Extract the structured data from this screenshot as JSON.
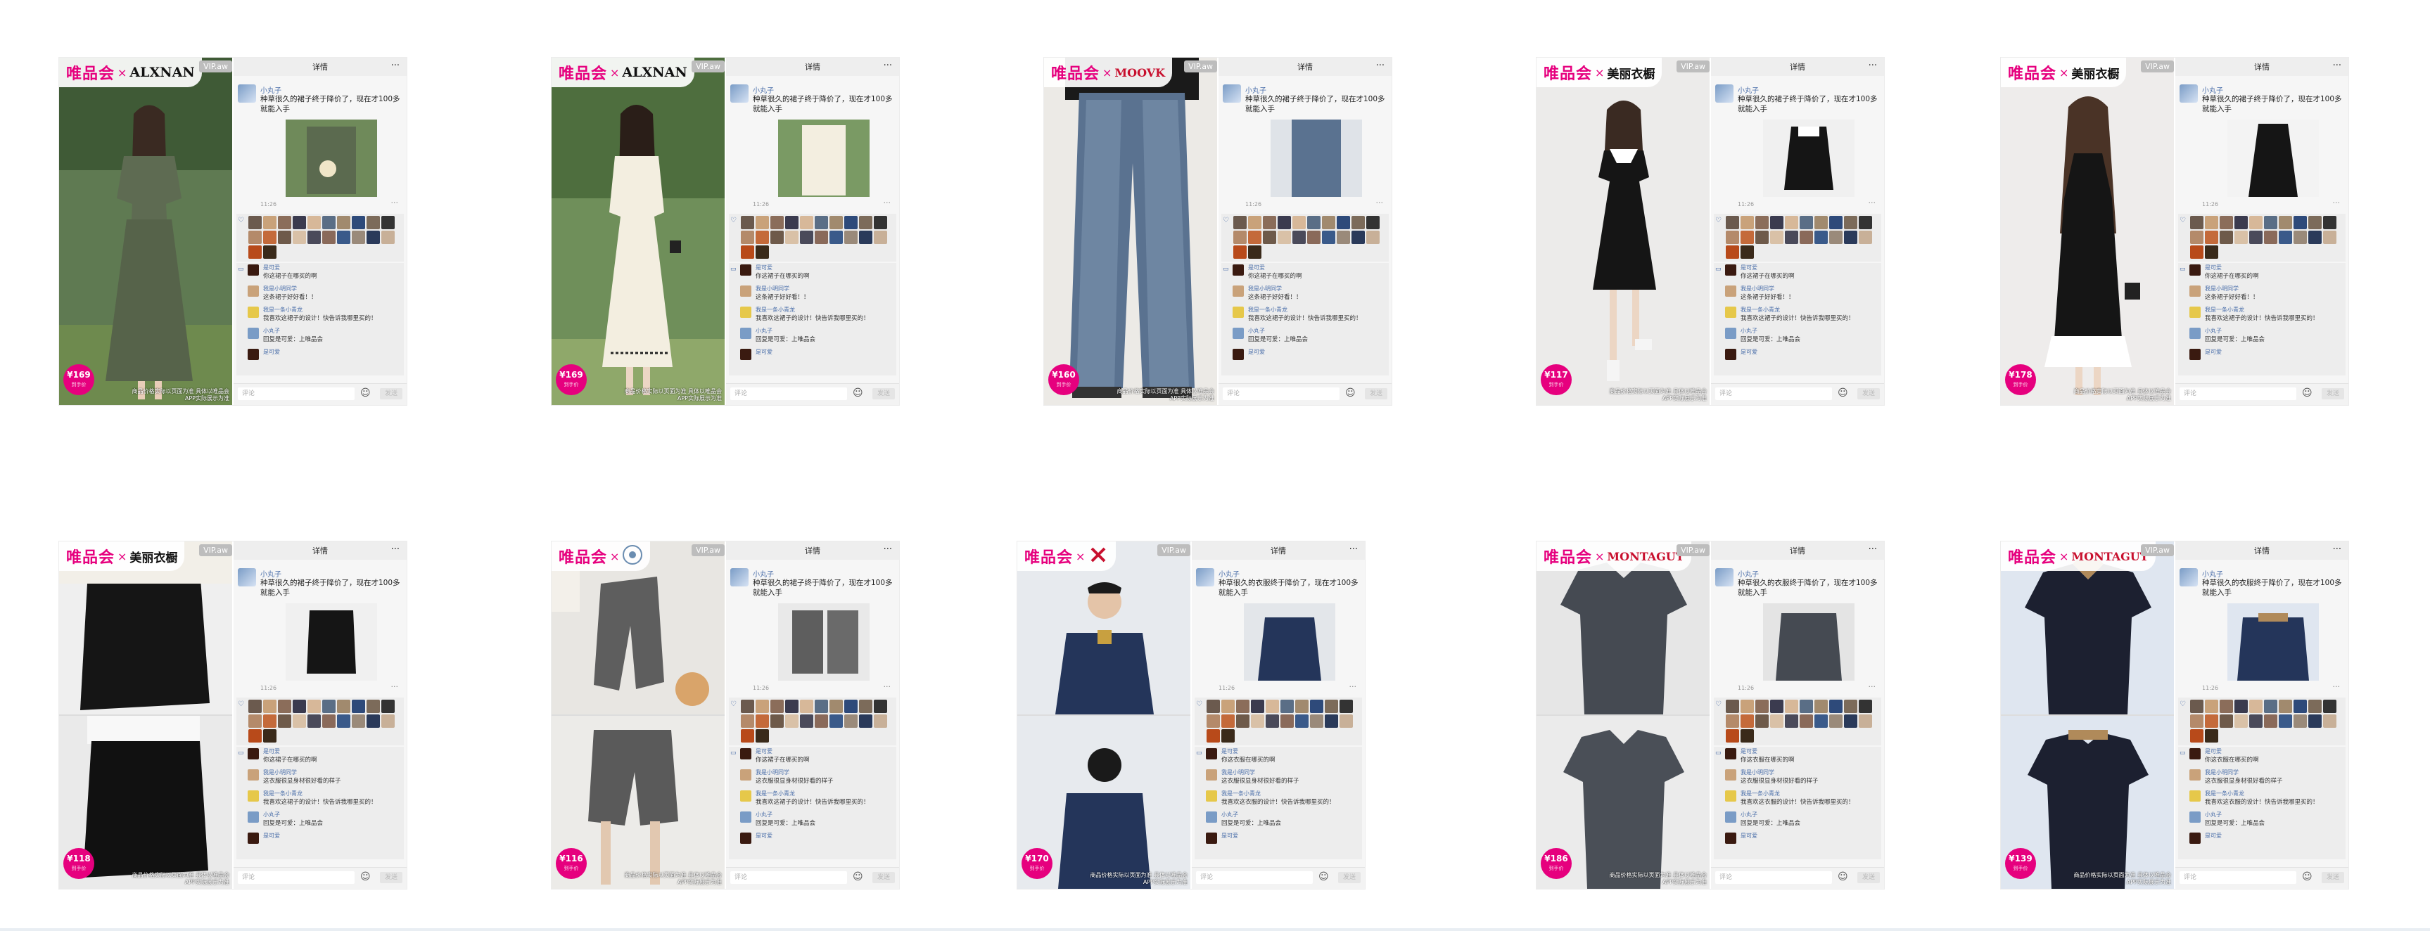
{
  "common": {
    "brand_wph": "唯品会",
    "brand_x": "×",
    "vip_tag": "VIP.aw",
    "topbar_title": "详情",
    "more": "···",
    "nick": "小丸子",
    "post_text_dress": "种草很久的裙子终于降价了，现在才100多就能入手",
    "post_text_men": "种草很久的衣服终于降价了，现在才100多就能入手",
    "time": "11:26",
    "like_heart": "♡",
    "comment_icon": "▭",
    "input_placeholder": "评论",
    "emoji": "☺",
    "send": "发送",
    "price_sub": "到手价",
    "disclaimer": "商品价格实际以页面为准 具体以唯品会APP实际展示为准",
    "comments_dress": [
      {
        "name": "是可爱",
        "text": "你这裙子在哪买的啊"
      },
      {
        "name": "我是小明同学",
        "text": "这条裙子好好看！！"
      },
      {
        "name": "我是一条小青龙",
        "text": "我喜欢这裙子的设计！快告诉我哪里买的！"
      },
      {
        "name": "小丸子",
        "text": "回复是可爱：上唯品会"
      },
      {
        "name": "是可爱",
        "text": ""
      }
    ],
    "comments_men": [
      {
        "name": "是可爱",
        "text": "你这衣服在哪买的啊"
      },
      {
        "name": "我是小明同学",
        "text": "这衣服很显身材很好看的样子"
      },
      {
        "name": "我是一条小青龙",
        "text": "我喜欢这衣服的设计！快告诉我哪里买的！"
      },
      {
        "name": "小丸子",
        "text": "回复是可爱：上唯品会"
      },
      {
        "name": "是可爱",
        "text": ""
      }
    ]
  },
  "ads": [
    {
      "brand": "ALXNAN",
      "price": "¥169"
    },
    {
      "brand": "ALXNAN",
      "price": "¥169"
    },
    {
      "brand": "MOOVK",
      "price": "¥160"
    },
    {
      "brand": "美丽衣橱",
      "price": "¥117"
    },
    {
      "brand": "美丽衣橱",
      "price": "¥178"
    },
    {
      "brand": "美丽衣橱",
      "price": "¥118"
    },
    {
      "brand": "",
      "price": "¥116"
    },
    {
      "brand": "",
      "price": "¥170"
    },
    {
      "brand": "MONTAGUT",
      "price": "¥186"
    },
    {
      "brand": "MONTAGUT",
      "price": "¥139"
    }
  ],
  "colors": {
    "accent": "#e6007e",
    "link": "#4a6ea9",
    "panel": "#f6f6f6"
  }
}
